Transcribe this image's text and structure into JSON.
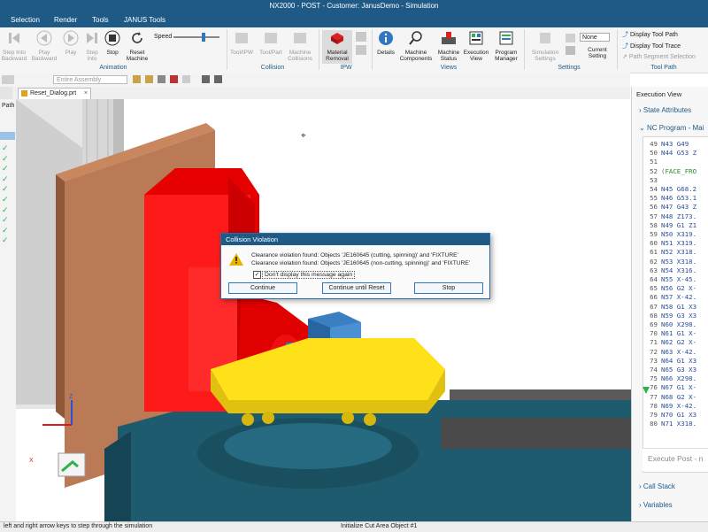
{
  "window": {
    "title": "NX2000 - POST - Customer: JanusDemo - Simulation"
  },
  "menu": [
    "Selection",
    "Render",
    "Tools",
    "JANUS Tools"
  ],
  "ribbon": {
    "speed_label": "Speed",
    "animation": {
      "group_label": "Animation",
      "buttons": [
        "Step Into Backward",
        "Play Backward",
        "Play",
        "Step Into",
        "Stop",
        "Reset Machine"
      ]
    },
    "collision": {
      "group_label": "Collision",
      "buttons": [
        "Tool/IPW",
        "Tool/Part",
        "Machine Collisions"
      ]
    },
    "ipw": {
      "group_label": "IPW",
      "buttons": [
        "Material Removal"
      ]
    },
    "views": {
      "group_label": "Views",
      "buttons": [
        "Details",
        "Machine Components",
        "Machine Status",
        "Execution View",
        "Program Manager"
      ]
    },
    "settings": {
      "group_label": "Settings",
      "buttons": [
        "Simulation Settings",
        "Current Setting"
      ],
      "none_value": "None"
    },
    "toolpath": {
      "group_label": "Tool Path",
      "items": [
        "Display Tool Path",
        "Display Tool Trace",
        "Path Segment Selection"
      ]
    }
  },
  "toolbar": {
    "assembly_select": "Entire Assembly"
  },
  "file_tab": {
    "label": "Reset_Dialog.prt"
  },
  "left_strip": {
    "header": "Path"
  },
  "execution_view": {
    "title": "Execution View",
    "state_attributes": "State Attributes",
    "nc_program": "NC Program - Mai",
    "lines": [
      {
        "n": "49",
        "t": "N43 G49"
      },
      {
        "n": "50",
        "t": "N44 G53 Z"
      },
      {
        "n": "51",
        "t": ""
      },
      {
        "n": "52",
        "t": "(FACE_FRO"
      },
      {
        "n": "53",
        "t": ""
      },
      {
        "n": "54",
        "t": "N45 G68.2"
      },
      {
        "n": "55",
        "t": "N46 G53.1"
      },
      {
        "n": "56",
        "t": "N47 G43 Z"
      },
      {
        "n": "57",
        "t": "N48 Z173."
      },
      {
        "n": "58",
        "t": "N49 G1 Z1"
      },
      {
        "n": "59",
        "t": "N50 X319."
      },
      {
        "n": "60",
        "t": "N51 X319."
      },
      {
        "n": "61",
        "t": "N52 X318."
      },
      {
        "n": "62",
        "t": "N53 X318."
      },
      {
        "n": "63",
        "t": "N54 X316."
      },
      {
        "n": "64",
        "t": "N55 X-45."
      },
      {
        "n": "65",
        "t": "N56 G2 X-"
      },
      {
        "n": "66",
        "t": "N57 X-42."
      },
      {
        "n": "67",
        "t": "N58 G1 X3"
      },
      {
        "n": "68",
        "t": "N59 G3 X3"
      },
      {
        "n": "69",
        "t": "N60 X298."
      },
      {
        "n": "70",
        "t": "N61 G1 X-"
      },
      {
        "n": "71",
        "t": "N62 G2 X-"
      },
      {
        "n": "72",
        "t": "N63 X-42."
      },
      {
        "n": "73",
        "t": "N64 G1 X3"
      },
      {
        "n": "74",
        "t": "N65 G3 X3"
      },
      {
        "n": "75",
        "t": "N66 X298."
      },
      {
        "n": "76",
        "t": "N67 G1 X-"
      },
      {
        "n": "77",
        "t": "N68 G2 X-"
      },
      {
        "n": "78",
        "t": "N69 X-42."
      },
      {
        "n": "79",
        "t": "N70 G1 X3"
      },
      {
        "n": "80",
        "t": "N71 X318."
      }
    ],
    "execute_post": "Execute Post - n",
    "call_stack": "Call Stack",
    "variables": "Variables"
  },
  "dialog": {
    "title": "Collision Violation",
    "message1": "Clearance violation found: Objects 'JE160645 (cutting, spinning)' and 'FIXTURE'",
    "message2": "Clearance violation found: Objects 'JE160645 (non-cutting, spinning)' and 'FIXTURE'",
    "checkbox_label": "Don't display this message again",
    "checkbox_checked": true,
    "buttons": {
      "continue": "Continue",
      "continue_until_reset": "Continue until Reset",
      "stop": "Stop"
    }
  },
  "status": {
    "left": "left and right arrow keys to step through the simulation",
    "center": "Initialize Cut Area Object #1"
  },
  "triad": {
    "x": "X",
    "z": "Z"
  },
  "colors": {
    "titlebar": "#1f5a86",
    "accent": "#2f78c0",
    "robot_red": "#ff1a1a",
    "table_yellow": "#ffe11a",
    "machine_teal": "#1e5b6e",
    "wall_brown": "#b97a55",
    "fixture_green": "#2bb24a"
  }
}
